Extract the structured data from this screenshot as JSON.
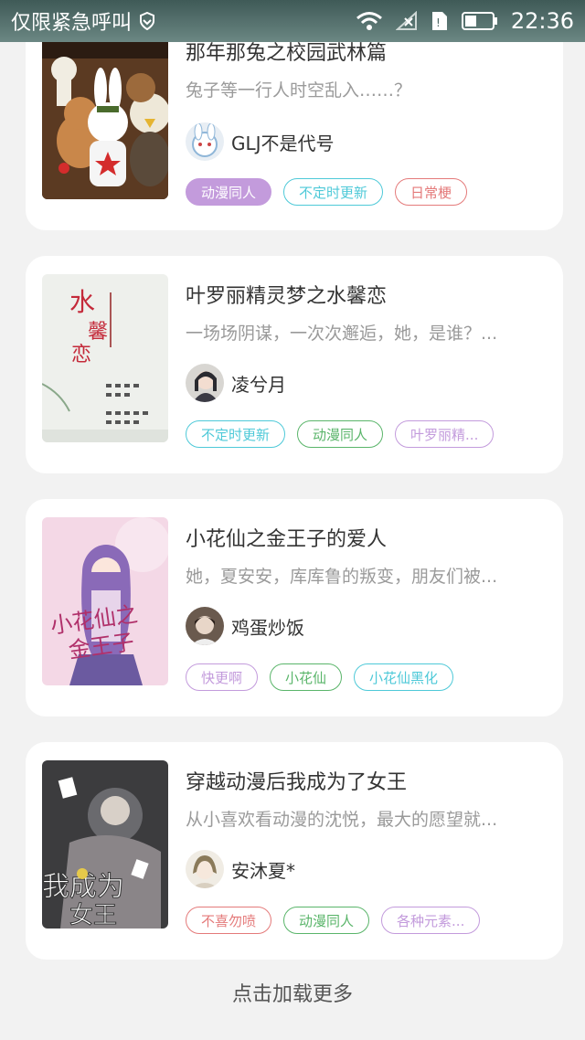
{
  "status_bar": {
    "carrier": "仅限紧急呼叫",
    "time": "22:36"
  },
  "colors": {
    "purple": "#c39bdc",
    "cyan": "#4ec9d8",
    "red": "#e47a7a",
    "green": "#5ab56a"
  },
  "stories": [
    {
      "title": "那年那兔之校园武林篇",
      "summary": "兔子等一行人时空乱入……？",
      "author": "GLJ不是代号",
      "tags": [
        {
          "label": "动漫同人",
          "color": "#c39bdc",
          "filled": true
        },
        {
          "label": "不定时更新",
          "color": "#4ec9d8",
          "filled": false
        },
        {
          "label": "日常梗",
          "color": "#e47a7a",
          "filled": false
        }
      ]
    },
    {
      "title": "叶罗丽精灵梦之水馨恋",
      "summary": "一场场阴谋，一次次邂逅，她，是谁？...",
      "author": "凌兮月",
      "tags": [
        {
          "label": "不定时更新",
          "color": "#4ec9d8",
          "filled": false
        },
        {
          "label": "动漫同人",
          "color": "#5ab56a",
          "filled": false
        },
        {
          "label": "叶罗丽精...",
          "color": "#c39bdc",
          "filled": false
        }
      ]
    },
    {
      "title": "小花仙之金王子的爱人",
      "summary": "她，夏安安，库库鲁的叛变，朋友们被...",
      "author": "鸡蛋炒饭",
      "tags": [
        {
          "label": "快更啊",
          "color": "#c39bdc",
          "filled": false
        },
        {
          "label": "小花仙",
          "color": "#5ab56a",
          "filled": false
        },
        {
          "label": "小花仙黑化",
          "color": "#4ec9d8",
          "filled": false
        }
      ]
    },
    {
      "title": "穿越动漫后我成为了女王",
      "summary": "从小喜欢看动漫的沈悦，最大的愿望就...",
      "author": "安沐夏*",
      "tags": [
        {
          "label": "不喜勿喷",
          "color": "#e47a7a",
          "filled": false
        },
        {
          "label": "动漫同人",
          "color": "#5ab56a",
          "filled": false
        },
        {
          "label": "各种元素...",
          "color": "#c39bdc",
          "filled": false
        }
      ]
    }
  ],
  "load_more": "点击加载更多"
}
